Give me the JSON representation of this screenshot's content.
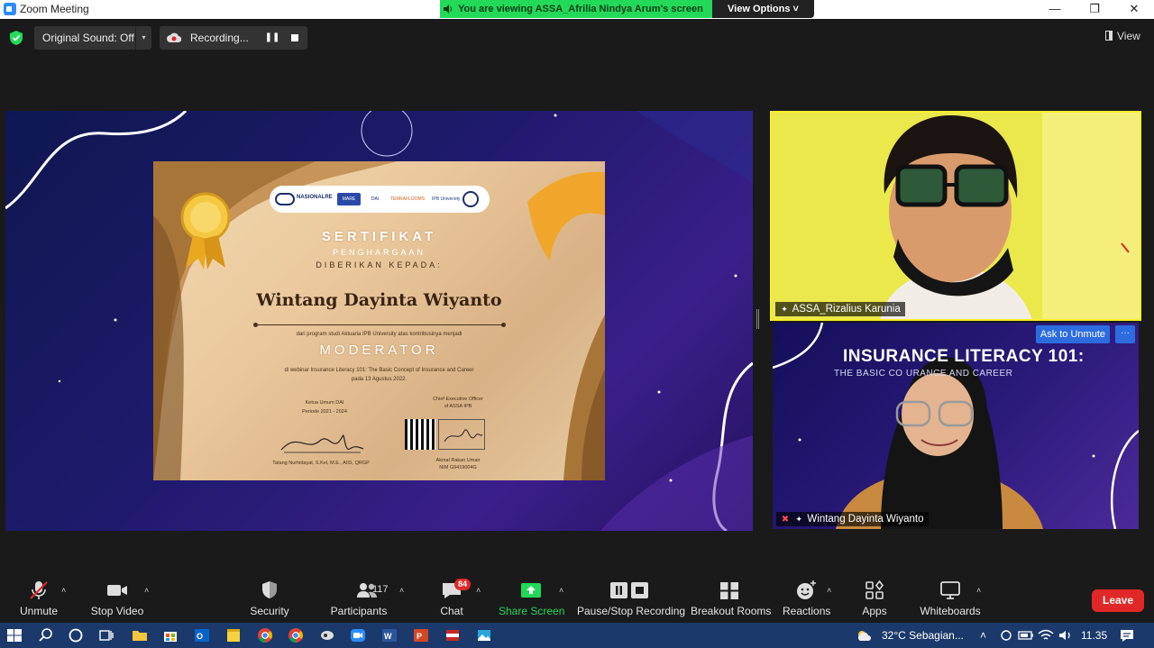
{
  "window": {
    "title": "Zoom Meeting",
    "viewing_banner": "You are viewing ASSA_Afrilia Nindya Arum's screen",
    "view_options": "View Options ˅",
    "minimize": "—",
    "restore": "❐",
    "close": "✕"
  },
  "topbar": {
    "original_sound": "Original Sound: Off",
    "original_sound_caret": "▾",
    "recording_label": "Recording...",
    "pause_symbol": "❚❚",
    "view_label": "View"
  },
  "certificate": {
    "logos": [
      "NASIONALRE",
      "MARE",
      "DAI",
      "TERRAFLOOMS",
      "IPB University",
      "ASSA"
    ],
    "title": "SERTIFIKAT",
    "subtitle": "PENGHARGAAN",
    "given_to": "DIBERIKAN KEPADA:",
    "recipient": "Wintang Dayinta Wiyanto",
    "from_text": "dari program studi Aktuaria IPB University atas kontribusinya menjadi",
    "role": "MODERATOR",
    "desc_line1": "di webinar Insurance Literacy 101: The Basic Concept of Insurance and Career",
    "desc_line2": "pada 13 Agustus 2022.",
    "sig1_title_line1": "Ketua Umum DAI",
    "sig1_title_line2": "Periode 2021 - 2024",
    "sig1_name": "Tatang Nurhidayat, S.Kel, M.E., AIIS, QRGP",
    "sig2_title_line1": "Chief Executive Officer",
    "sig2_title_line2": "of ASSA IPB",
    "sig2_name_line1": "Akmal Rakan Umair",
    "sig2_name_line2": "NIM G9419004G"
  },
  "participants_video": [
    {
      "name": "ASSA_Rizalius Karunia",
      "muted": false
    },
    {
      "name": "Wintang Dayinta Wiyanto",
      "muted": true,
      "background_title": "INSURANCE LITERACY 101:",
      "background_subtitle": "THE BASIC CO        URANCE AND CAREER",
      "ask_to_unmute": "Ask to Unmute",
      "more": "···"
    }
  ],
  "toolbar": {
    "unmute": "Unmute",
    "stop_video": "Stop Video",
    "security": "Security",
    "participants": "Participants",
    "participants_count": "117",
    "chat": "Chat",
    "chat_badge": "84",
    "share_screen": "Share Screen",
    "pause_stop_recording": "Pause/Stop Recording",
    "breakout_rooms": "Breakout Rooms",
    "reactions": "Reactions",
    "apps": "Apps",
    "whiteboards": "Whiteboards",
    "leave": "Leave",
    "caret": "˄"
  },
  "taskbar": {
    "weather": "32°C  Sebagian...",
    "time": "11.35",
    "tray_caret": "˄"
  },
  "colors": {
    "zoom_green": "#23d959",
    "zoom_blue": "#2d8cff",
    "leave_red": "#e02828",
    "active_speaker_border": "#f6f02b"
  }
}
